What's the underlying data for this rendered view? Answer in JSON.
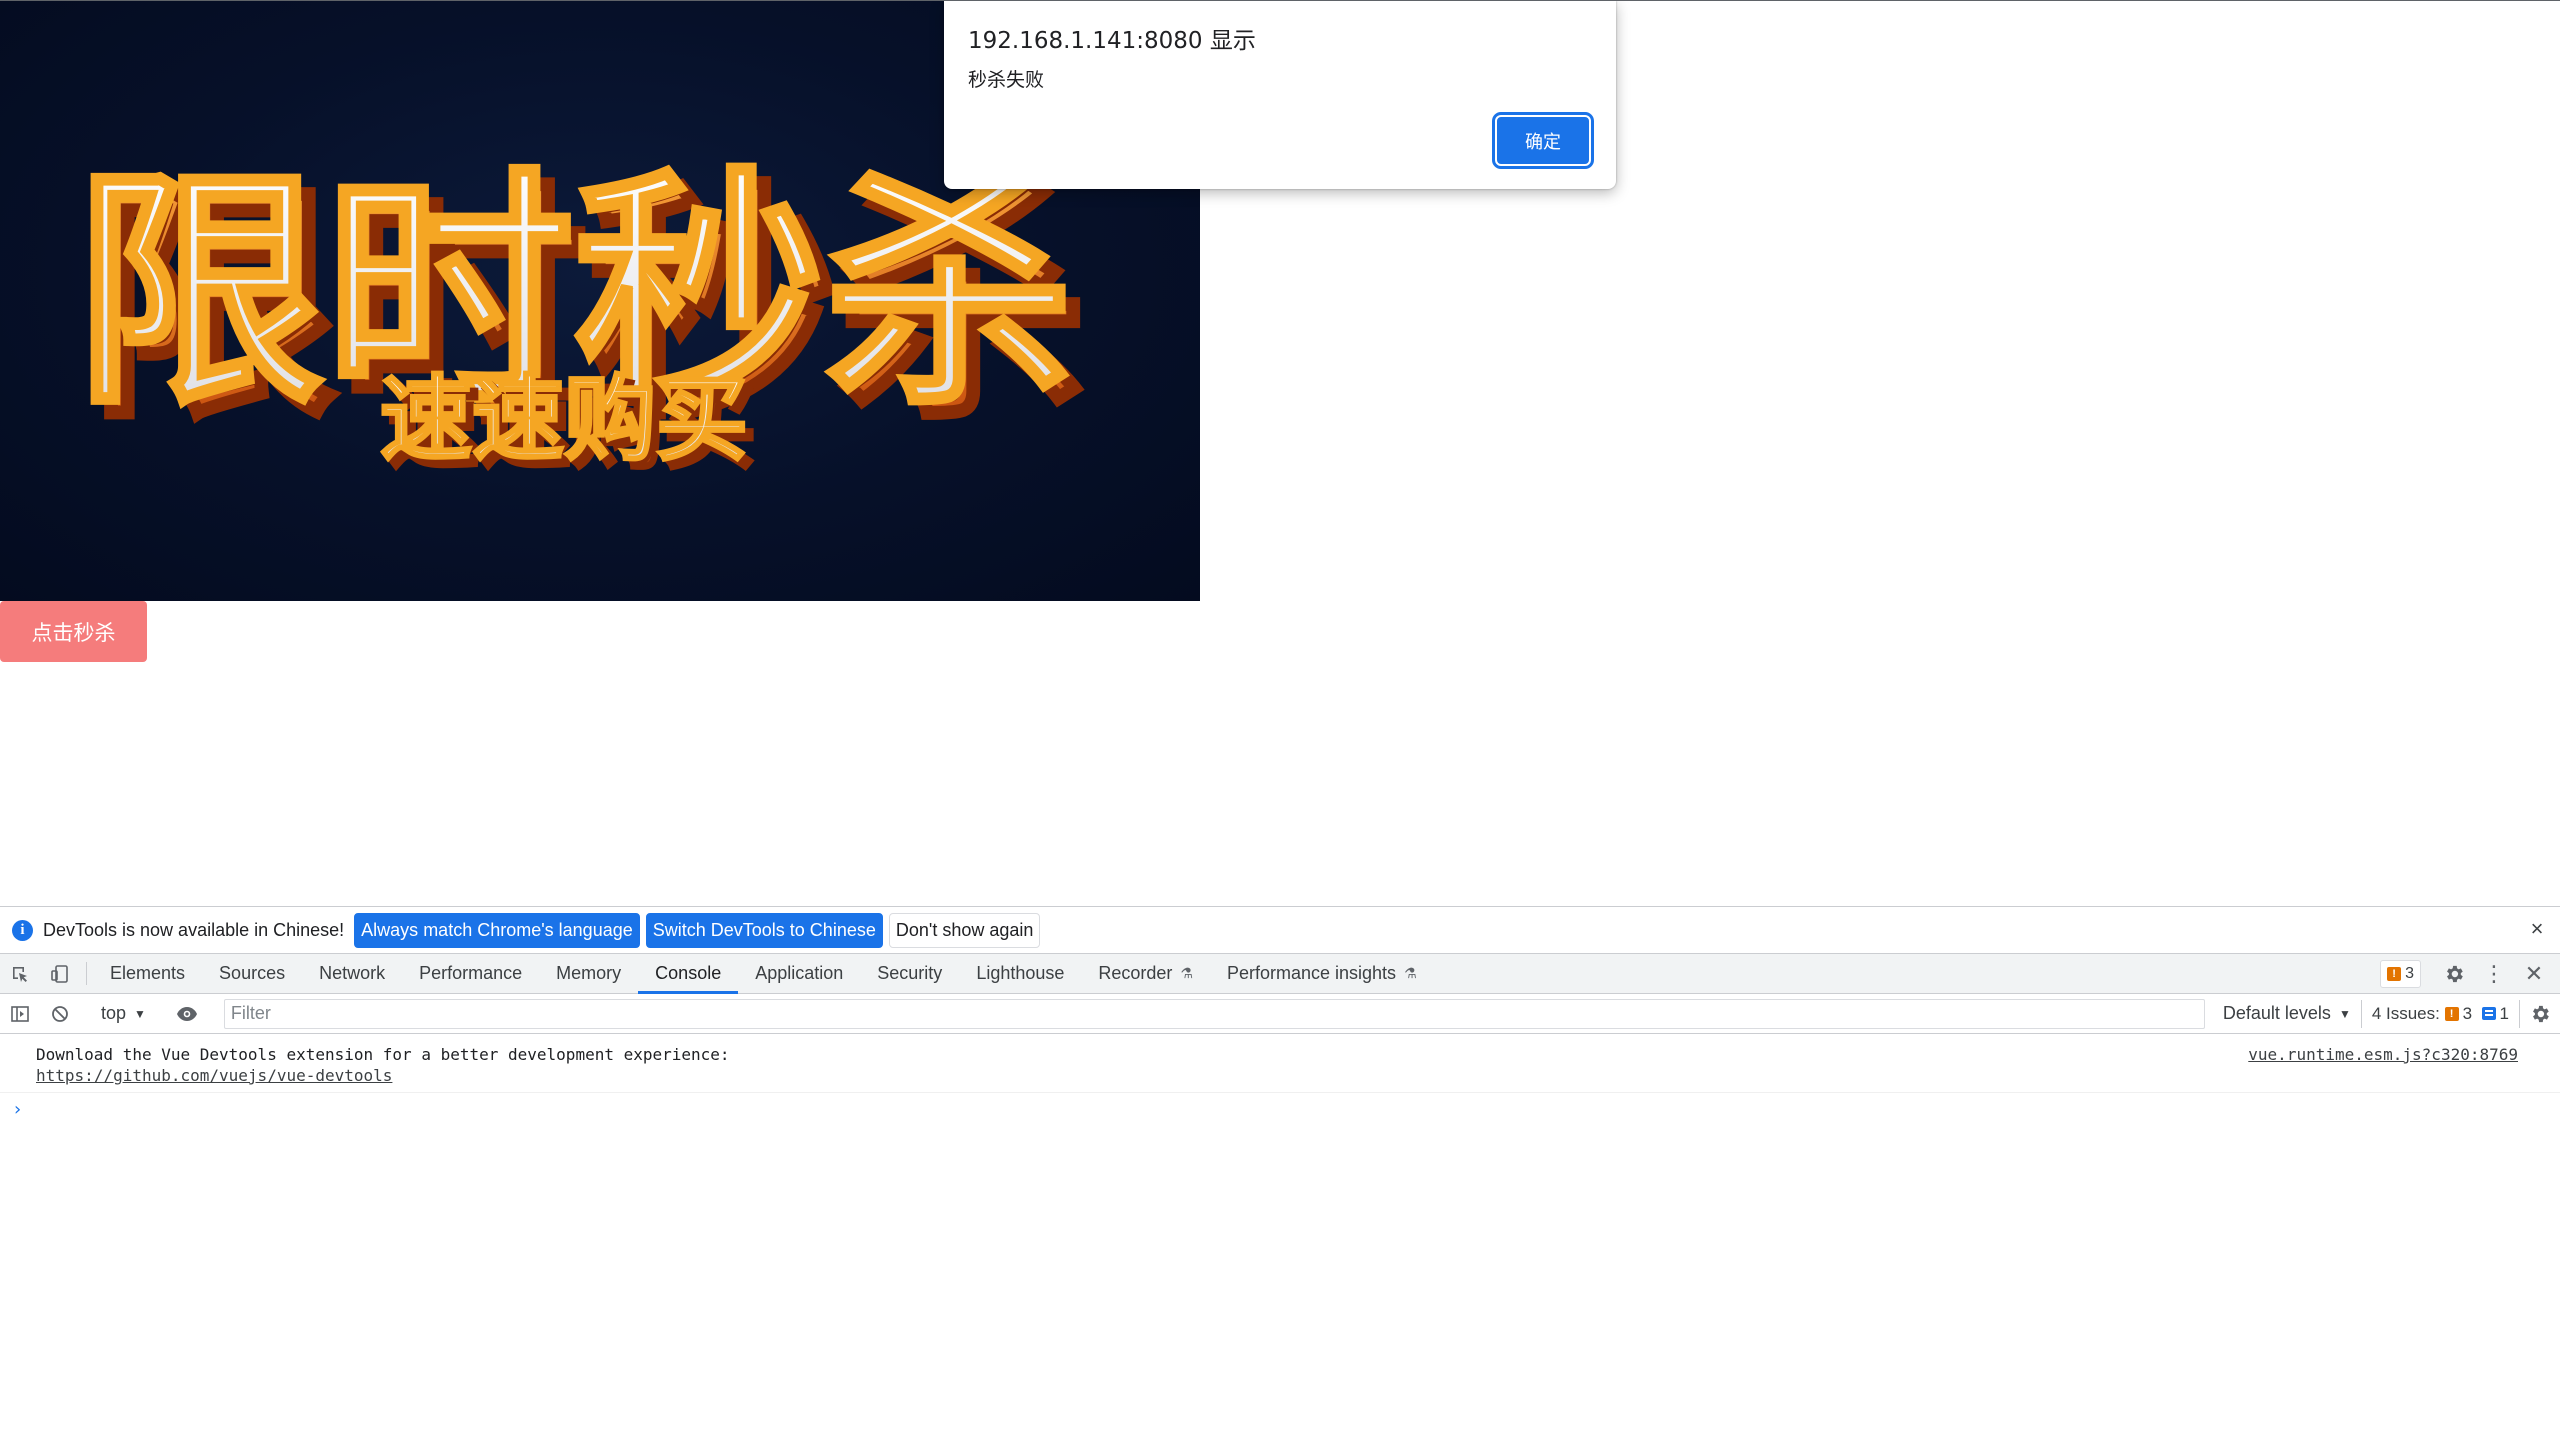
{
  "page": {
    "banner": {
      "headline": "限时秒杀",
      "tagline": "速速购买",
      "colors": {
        "background": "#061029",
        "letter_face": "#f4f4f6",
        "letter_edge": "#e8650f"
      }
    },
    "seckill_button": {
      "label": "点击秒杀",
      "color": "#f57c7c"
    }
  },
  "alert": {
    "title": "192.168.1.141:8080 显示",
    "message": "秒杀失败",
    "ok_label": "确定"
  },
  "devtools": {
    "infobar": {
      "text": "DevTools is now available in Chinese!",
      "always_match_label": "Always match Chrome's language",
      "switch_label": "Switch DevTools to Chinese",
      "dont_show_label": "Don't show again"
    },
    "tabs": [
      {
        "label": "Elements"
      },
      {
        "label": "Sources"
      },
      {
        "label": "Network"
      },
      {
        "label": "Performance"
      },
      {
        "label": "Memory"
      },
      {
        "label": "Console",
        "active": true
      },
      {
        "label": "Application"
      },
      {
        "label": "Security"
      },
      {
        "label": "Lighthouse"
      },
      {
        "label": "Recorder",
        "experimental": true
      },
      {
        "label": "Performance insights",
        "experimental": true
      }
    ],
    "issues_badge_count": "3",
    "console_toolbar": {
      "context": "top",
      "filter_placeholder": "Filter",
      "levels": "Default levels",
      "issues_label": "4 Issues:",
      "issues_warning_count": "3",
      "issues_info_count": "1"
    },
    "console": {
      "messages": [
        {
          "text": "Download the Vue Devtools extension for a better development experience:",
          "link": "https://github.com/vuejs/vue-devtools",
          "source": "vue.runtime.esm.js?c320:8769"
        }
      ],
      "prompt": "›"
    },
    "colors": {
      "accent": "#1a73e8",
      "warning": "#e37400"
    }
  }
}
